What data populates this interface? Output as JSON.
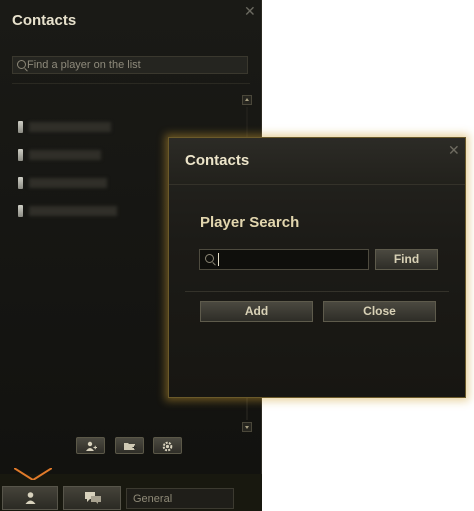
{
  "contacts_panel": {
    "title": "Contacts",
    "close_glyph": "✕",
    "search_placeholder": "Find a player on the list",
    "contacts": [
      {
        "status_icon": "player-status-icon",
        "name_blurred": true
      },
      {
        "status_icon": "player-status-icon",
        "name_blurred": true
      },
      {
        "status_icon": "player-status-icon",
        "name_blurred": true
      },
      {
        "status_icon": "player-status-icon",
        "name_blurred": true
      }
    ],
    "toolbar": [
      {
        "icon": "add-contact-icon"
      },
      {
        "icon": "add-group-icon"
      },
      {
        "icon": "settings-gear-icon"
      }
    ]
  },
  "bottom_bar": {
    "contacts_icon": "contacts-person-icon",
    "chat_icon": "chat-bubbles-icon",
    "channel_label": "General"
  },
  "search_dialog": {
    "title": "Contacts",
    "close_glyph": "✕",
    "subtitle": "Player Search",
    "input_value": "",
    "find_label": "Find",
    "add_label": "Add",
    "close_label": "Close"
  },
  "colors": {
    "panel_bg": "#151512",
    "dialog_glow": "#cea032",
    "title_text": "#e7e1cc",
    "subtitle_text": "#e2d6ae"
  }
}
